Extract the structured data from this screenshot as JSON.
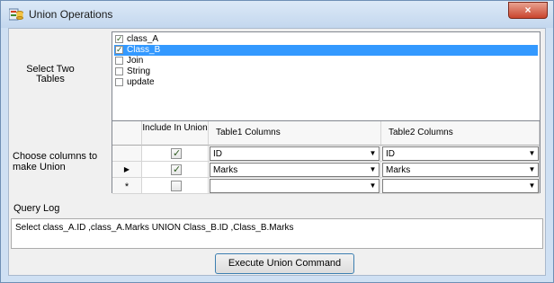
{
  "window": {
    "title": "Union Operations",
    "close_glyph": "×"
  },
  "labels": {
    "select_tables": "Select Two Tables",
    "choose_columns": "Choose columns to make Union",
    "query_log": "Query Log"
  },
  "tables": [
    {
      "label": "class_A",
      "checked": true,
      "selected": false
    },
    {
      "label": "Class_B",
      "checked": true,
      "selected": true
    },
    {
      "label": "Join",
      "checked": false,
      "selected": false
    },
    {
      "label": "String",
      "checked": false,
      "selected": false
    },
    {
      "label": "update",
      "checked": false,
      "selected": false
    }
  ],
  "grid": {
    "headers": {
      "include": "Include In Union",
      "table1": "Table1 Columns",
      "table2": "Table2 Columns"
    },
    "rows": [
      {
        "marker": "",
        "include": true,
        "table1": "ID",
        "table2": "ID"
      },
      {
        "marker": "▶",
        "include": true,
        "table1": "Marks",
        "table2": "Marks"
      },
      {
        "marker": "*",
        "include": false,
        "table1": "",
        "table2": ""
      }
    ]
  },
  "query_log": "Select class_A.ID ,class_A.Marks  UNION Class_B.ID ,Class_B.Marks",
  "execute_button": "Execute Union Command",
  "colors": {
    "selection": "#3399ff",
    "frame": "#cfe0f3",
    "close": "#c9452d"
  }
}
